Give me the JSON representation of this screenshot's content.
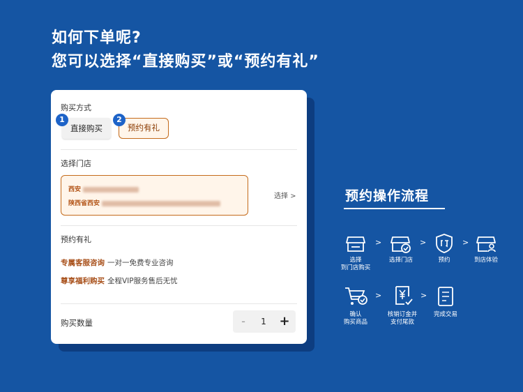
{
  "heading": {
    "line1": "如何下单呢?",
    "line2": "您可以选择“直接购买”或“预约有礼”"
  },
  "card": {
    "purchase_method_label": "购买方式",
    "option1": {
      "badge": "1",
      "label": "直接购买"
    },
    "option2": {
      "badge": "2",
      "label": "预约有礼"
    },
    "store_label": "选择门店",
    "store": {
      "city": "西安",
      "address_prefix": "陕西省西安"
    },
    "select_link": "选择 >",
    "gift_label": "预约有礼",
    "gifts": [
      {
        "tag": "专属客服咨询",
        "desc": "一对一免费专业咨询"
      },
      {
        "tag": "尊享福利购买",
        "desc": "全程VIP服务售后无忧"
      }
    ],
    "quantity_label": "购买数量",
    "quantity": {
      "minus": "-",
      "value": "1",
      "plus": "+"
    }
  },
  "flow": {
    "title": "预约操作流程",
    "row1": [
      {
        "label": "选择\n到门店购买",
        "icon": "store-icon"
      },
      {
        "label": "选择门店",
        "icon": "store-check-icon"
      },
      {
        "label": "预约",
        "icon": "reserve-shield-icon"
      },
      {
        "label": "到店体验",
        "icon": "store-person-icon"
      }
    ],
    "row2": [
      {
        "label": "确认\n购买商品",
        "icon": "cart-check-icon"
      },
      {
        "label": "核销订金并\n支付尾款",
        "icon": "yuan-receipt-icon"
      },
      {
        "label": "完成交易",
        "icon": "document-icon"
      }
    ],
    "arrow": ">"
  },
  "colors": {
    "background": "#1555a3",
    "accent": "#c46a1a",
    "badge": "#1d63c8"
  }
}
